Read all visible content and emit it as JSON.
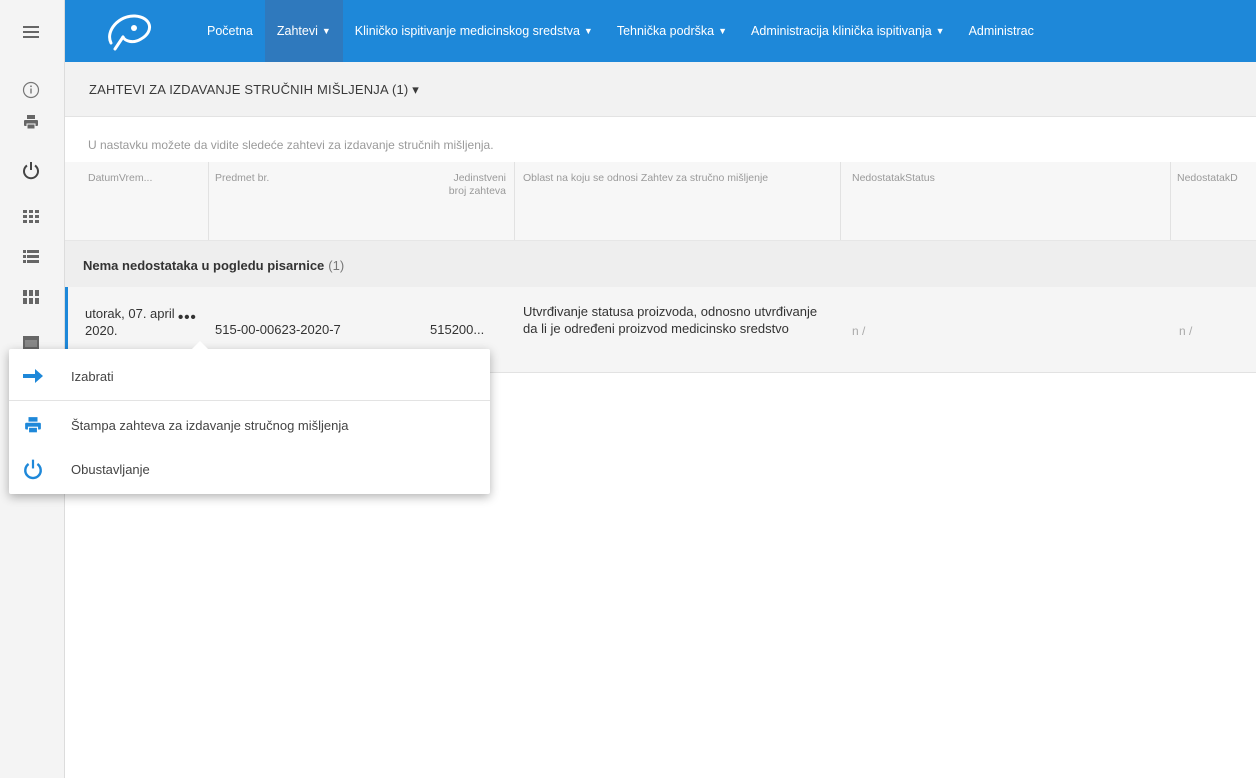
{
  "rail": {
    "icons": [
      "menu-icon",
      "info-icon",
      "print-icon",
      "power-icon",
      "grid-icon",
      "list-icon",
      "tiles-icon",
      "calendar-icon"
    ]
  },
  "nav": {
    "items": [
      {
        "label": "Početna",
        "dropdown": false,
        "active": false
      },
      {
        "label": "Zahtevi",
        "dropdown": true,
        "active": true
      },
      {
        "label": "Kliničko ispitivanje medicinskog sredstva",
        "dropdown": true,
        "active": false
      },
      {
        "label": "Tehnička podrška",
        "dropdown": true,
        "active": false
      },
      {
        "label": "Administracija klinička ispitivanja",
        "dropdown": true,
        "active": false
      },
      {
        "label": "Administrac",
        "dropdown": false,
        "active": false
      }
    ]
  },
  "section": {
    "title": "ZAHTEVI ZA IZDAVANJE STRUČNIH MIŠLJENJA (1) ▾"
  },
  "intro": "U nastavku možete da vidite sledeće zahtevi za izdavanje stručnih mišljenja.",
  "table": {
    "headers": [
      "DatumVrem...",
      "Predmet br.",
      "Jedinstveni broj zahteva",
      "Oblast na koju se odnosi Zahtev za stručno mišljenje",
      "NedostatakStatus",
      "NedostatakD"
    ],
    "group": {
      "label": "Nema nedostataka u pogledu pisarnice",
      "count": "(1)"
    },
    "row": {
      "date": "utorak, 07. april 2020.",
      "more": "•••",
      "predmet": "515-00-00623-2020-7",
      "broj": "515200...",
      "oblast": "Utvrđivanje statusa proizvoda, odnosno utvrđivanje da li je određeni proizvod medicinsko sredstvo",
      "status": "n /",
      "nedostatak": "n /"
    }
  },
  "popup": {
    "items": [
      {
        "label": "Izabrati",
        "icon": "arrow-right-icon"
      },
      {
        "label": "Štampa zahteva za izdavanje stručnog mišljenja",
        "icon": "print-icon"
      },
      {
        "label": "Obustavljanje",
        "icon": "power-icon"
      }
    ]
  },
  "colors": {
    "accent": "#1e88d9",
    "nav_active": "#2f79bd"
  }
}
